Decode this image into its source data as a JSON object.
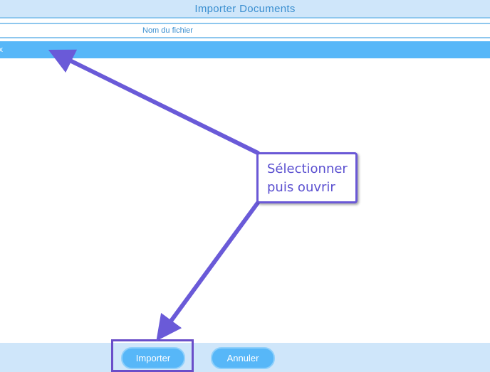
{
  "dialog": {
    "title": "Importer Documents"
  },
  "file_list": {
    "column_header": "Nom du fichier",
    "selected_file_fragment": "cx"
  },
  "footer": {
    "import_label": "Importer",
    "cancel_label": "Annuler"
  },
  "annotation": {
    "line1": "Sélectionner",
    "line2": "puis ouvrir"
  },
  "colors": {
    "accent": "#57b7f8",
    "title_text": "#3b8fd0",
    "annotation": "#6a58d6"
  }
}
